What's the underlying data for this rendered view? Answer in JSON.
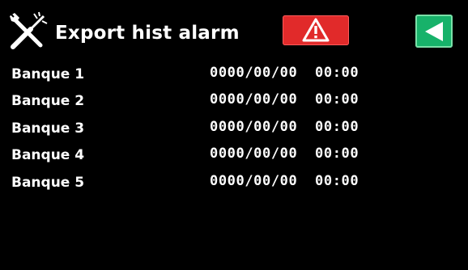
{
  "header": {
    "title": "Export hist alarm",
    "icon": "tools-icon",
    "alarm_button_icon": "warning-triangle-icon",
    "back_button_icon": "back-arrow-icon"
  },
  "colors": {
    "background": "#000000",
    "text": "#ffffff",
    "alarm_button": "#e12a2a",
    "back_button": "#17b26a"
  },
  "rows": [
    {
      "label": "Banque 1",
      "value": "0000/00/00  00:00"
    },
    {
      "label": "Banque 2",
      "value": "0000/00/00  00:00"
    },
    {
      "label": "Banque 3",
      "value": "0000/00/00  00:00"
    },
    {
      "label": "Banque 4",
      "value": "0000/00/00  00:00"
    },
    {
      "label": "Banque 5",
      "value": "0000/00/00  00:00"
    }
  ]
}
